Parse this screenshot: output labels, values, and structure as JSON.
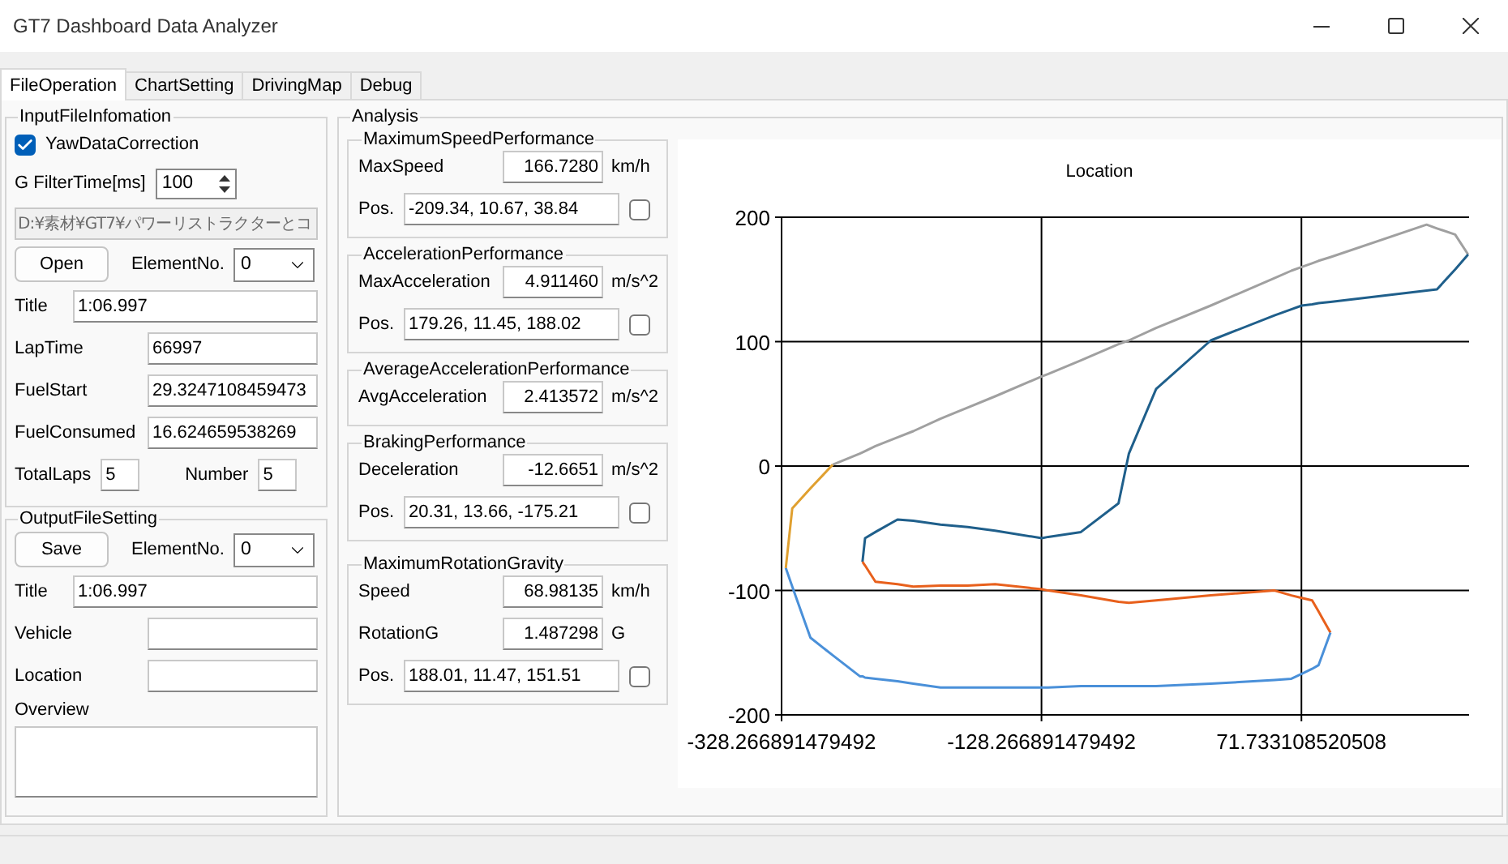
{
  "window": {
    "title": "GT7 Dashboard Data Analyzer"
  },
  "tabs": [
    {
      "label": "FileOperation",
      "selected": true
    },
    {
      "label": "ChartSetting",
      "selected": false
    },
    {
      "label": "DrivingMap",
      "selected": false
    },
    {
      "label": "Debug",
      "selected": false
    }
  ],
  "input_file": {
    "title": "InputFileInfomation",
    "yaw_correction": {
      "label": "YawDataCorrection",
      "checked": true
    },
    "filter": {
      "label": "G FilterTime[ms]",
      "value": "100"
    },
    "path": {
      "value": "D:¥素材¥GT7¥パワーリストラクターとコ",
      "disabled": true
    },
    "open_button": "Open",
    "element": {
      "label": "ElementNo.",
      "value": "0"
    },
    "fields": [
      {
        "kind": "wide",
        "label": "Title",
        "value": "1:06.997"
      },
      {
        "kind": "narrow",
        "label": "LapTime",
        "value": "66997"
      },
      {
        "kind": "narrow",
        "label": "FuelStart",
        "value": "29.3247108459473"
      },
      {
        "kind": "narrow",
        "label": "FuelConsumed",
        "value": "16.624659538269"
      }
    ],
    "total_laps": {
      "label": "TotalLaps",
      "value": "5"
    },
    "number": {
      "label": "Number",
      "value": "5"
    }
  },
  "output_file": {
    "title": "OutputFileSetting",
    "save_button": "Save",
    "element": {
      "label": "ElementNo.",
      "value": "0"
    },
    "fields": [
      {
        "kind": "wide",
        "label": "Title",
        "value": "1:06.997"
      },
      {
        "kind": "narrow",
        "label": "Vehicle"
      },
      {
        "kind": "narrow",
        "label": "Location"
      }
    ],
    "overview": {
      "label": "Overview"
    }
  },
  "analysis": {
    "title": "Analysis",
    "groups": [
      {
        "title": "MaximumSpeedPerformance",
        "rows": [
          {
            "kind": "value",
            "label": "MaxSpeed",
            "value": "166.7280",
            "unit": "km/h"
          },
          {
            "kind": "pos",
            "label": "Pos.",
            "value": "-209.34, 10.67, 38.84",
            "checked": false
          }
        ]
      },
      {
        "title": "AccelerationPerformance",
        "rows": [
          {
            "kind": "value",
            "label": "MaxAcceleration",
            "value": "4.911460",
            "unit": "m/s^2"
          },
          {
            "kind": "pos",
            "label": "Pos.",
            "value": "179.26, 11.45, 188.02",
            "checked": false
          }
        ]
      },
      {
        "title": "AverageAccelerationPerformance",
        "rows": [
          {
            "kind": "value",
            "label": "AvgAcceleration",
            "value": "2.413572",
            "unit": "m/s^2"
          }
        ]
      },
      {
        "title": "BrakingPerformance",
        "rows": [
          {
            "kind": "value",
            "label": "Deceleration",
            "value": "-12.6651",
            "unit": "m/s^2"
          },
          {
            "kind": "pos",
            "label": "Pos.",
            "value": "20.31, 13.66, -175.21",
            "checked": false
          }
        ]
      },
      {
        "title": "MaximumRotationGravity",
        "rows": [
          {
            "kind": "value",
            "label": "Speed",
            "value": "68.98135",
            "unit": "km/h"
          },
          {
            "kind": "value",
            "label": "RotationG",
            "value": "1.487298",
            "unit": "G"
          },
          {
            "kind": "pos",
            "label": "Pos.",
            "value": "188.01, 11.47, 151.51",
            "checked": false
          }
        ]
      }
    ],
    "chart_data": {
      "type": "line",
      "title": "Location",
      "x": [
        -325,
        -320,
        -306,
        -289,
        -268,
        -266,
        -264,
        -256,
        -239,
        -227,
        -206,
        -185,
        -164,
        -128,
        -123,
        -98,
        -69,
        -61,
        -40,
        2,
        51,
        64,
        72,
        80,
        85,
        94,
        168,
        176,
        190,
        200
      ],
      "series": [
        {
          "color": "#a0a0a0",
          "values": [
            null,
            null,
            null,
            1,
            10,
            11,
            12,
            16,
            23,
            28,
            38,
            47,
            56,
            72,
            74,
            85,
            98,
            101,
            111,
            129,
            151,
            157,
            160,
            163,
            165,
            168,
            194,
            191,
            186,
            170
          ]
        },
        {
          "color": "#1f5f8b",
          "values": [
            null,
            null,
            null,
            null,
            null,
            -77,
            -58,
            -53,
            -43,
            -44,
            -47,
            -49,
            -52,
            -58,
            -57,
            -53,
            -30,
            10,
            62,
            101,
            121,
            126,
            129,
            130,
            131,
            132,
            141,
            142,
            158,
            170
          ]
        },
        {
          "color": "#e8601c",
          "values": [
            null,
            null,
            null,
            null,
            null,
            -77,
            -80,
            -93,
            -95,
            -97,
            -96,
            -96,
            -95,
            -99,
            -100,
            -104,
            -109,
            -110,
            -108,
            -104,
            -100,
            -104,
            -106,
            -108,
            -117,
            -134,
            null,
            null,
            null,
            null
          ]
        },
        {
          "color": "#4a90d9",
          "values": [
            -82,
            -97,
            -138,
            -152,
            -169,
            -169,
            -170,
            -171,
            -173,
            -175,
            -178,
            -178,
            -178,
            -178,
            -178,
            -177,
            -177,
            -177,
            -177,
            -175,
            -172,
            -171,
            -167,
            -163,
            -160,
            -134,
            null,
            null,
            null,
            null
          ]
        },
        {
          "color": "#e0a030",
          "values": [
            -82,
            -34,
            -18,
            1,
            null,
            null,
            null,
            null,
            null,
            null,
            null,
            null,
            null,
            null,
            null,
            null,
            null,
            null,
            null,
            null,
            null,
            null,
            null,
            null,
            null,
            null,
            null,
            null,
            null,
            null
          ]
        }
      ],
      "xlim": [
        -328.266891479492,
        200.733108520508
      ],
      "ylim": [
        -200,
        200
      ],
      "xticks": [
        {
          "value": -328.266891479492,
          "label": "-328.266891479492"
        },
        {
          "value": -128.266891479492,
          "label": "-128.266891479492"
        },
        {
          "value": 71.733108520508,
          "label": "71.733108520508"
        }
      ],
      "yticks": [
        -200,
        -100,
        0,
        100,
        200
      ],
      "grid": true
    }
  }
}
